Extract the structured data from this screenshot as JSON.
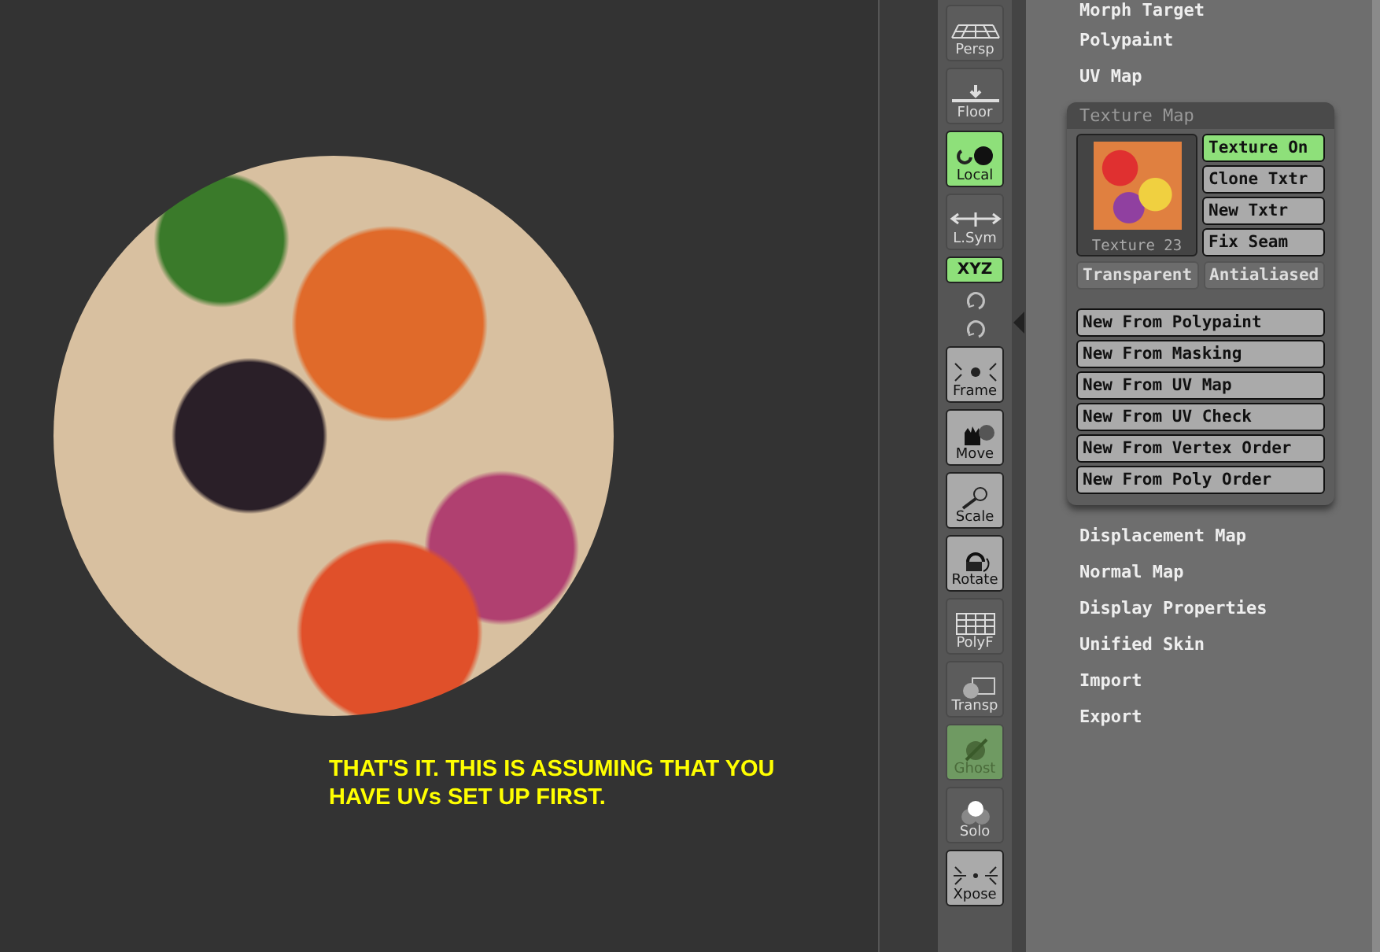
{
  "canvas": {
    "caption": "THAT'S IT. THIS IS ASSUMING THAT YOU\nHAVE UVs SET UP FIRST."
  },
  "shelf": [
    {
      "kind": "button",
      "label": "Persp",
      "on": false,
      "disabled": true
    },
    {
      "kind": "button",
      "label": "Floor",
      "on": false,
      "disabled": true
    },
    {
      "kind": "button",
      "label": "Local",
      "on": true,
      "disabled": false
    },
    {
      "kind": "button",
      "label": "L.Sym",
      "on": false,
      "disabled": true
    },
    {
      "kind": "toggle",
      "label": "XYZ",
      "on": true,
      "disabled": false
    },
    {
      "kind": "icon",
      "on": false,
      "disabled": true
    },
    {
      "kind": "icon",
      "on": false,
      "disabled": true
    },
    {
      "kind": "button",
      "label": "Frame",
      "on": false,
      "disabled": false
    },
    {
      "kind": "button",
      "label": "Move",
      "on": false,
      "disabled": false
    },
    {
      "kind": "button",
      "label": "Scale",
      "on": false,
      "disabled": false
    },
    {
      "kind": "button",
      "label": "Rotate",
      "on": false,
      "disabled": false
    },
    {
      "kind": "button",
      "label": "PolyF",
      "on": false,
      "disabled": true
    },
    {
      "kind": "button",
      "label": "Transp",
      "on": false,
      "disabled": true
    },
    {
      "kind": "button",
      "label": "Ghost",
      "on": true,
      "disabled": true
    },
    {
      "kind": "button",
      "label": "Solo",
      "on": false,
      "disabled": true
    },
    {
      "kind": "button",
      "label": "Xpose",
      "on": false,
      "disabled": false
    }
  ],
  "panel": {
    "items_before": [
      "Morph Target",
      "Polypaint",
      "UV Map"
    ],
    "texture_map": {
      "title": "Texture Map",
      "thumbnail_caption": "Texture 23",
      "side_buttons": [
        {
          "label": "Texture On",
          "on": true
        },
        {
          "label": "Clone Txtr",
          "on": false
        },
        {
          "label": "New Txtr",
          "on": false
        },
        {
          "label": "Fix Seam",
          "on": false
        }
      ],
      "toggles": [
        {
          "label": "Transparent",
          "on": false
        },
        {
          "label": "Antialiased",
          "on": false
        }
      ],
      "buttons": [
        "New From Polypaint",
        "New From Masking",
        "New From UV Map",
        "New From UV Check",
        "New From Vertex Order",
        "New From Poly Order"
      ]
    },
    "items_after": [
      "Displacement Map",
      "Normal Map",
      "Display Properties",
      "Unified Skin",
      "Import",
      "Export"
    ]
  }
}
